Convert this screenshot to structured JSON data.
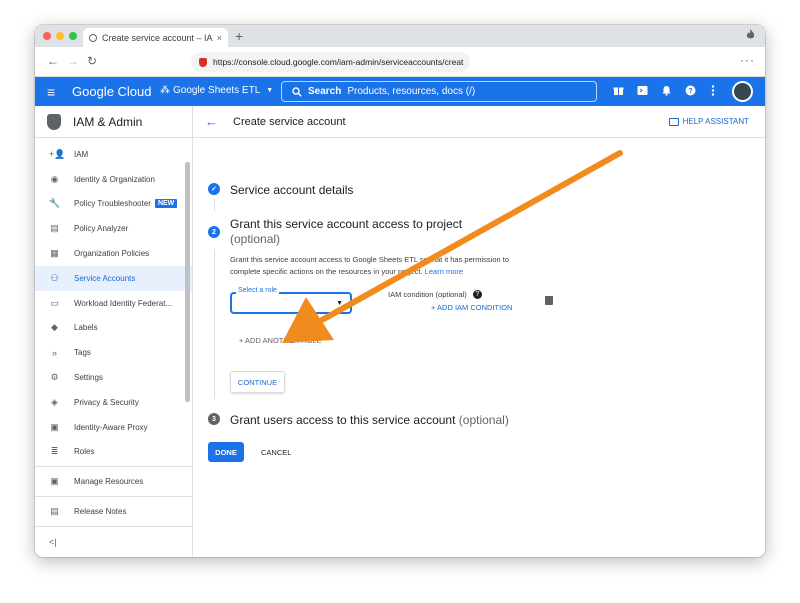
{
  "browser": {
    "tab_title": "Create service account – IAM",
    "tab_close": "×",
    "new_tab": "+",
    "url": "https://console.cloud.google.com/iam-admin/serviceaccounts/creat",
    "back": "←",
    "forward": "→",
    "reload": "↻",
    "more": "···"
  },
  "header": {
    "menu": "≡",
    "brand": "Google Cloud",
    "project": "Google Sheets ETL",
    "project_caret": "▼",
    "search_label": "Search",
    "search_placeholder": "Products, resources, docs (/)"
  },
  "sidebar": {
    "title": "IAM & Admin",
    "items": [
      {
        "label": "IAM",
        "icon": "+👤"
      },
      {
        "label": "Identity & Organization",
        "icon": "◉"
      },
      {
        "label": "Policy Troubleshooter",
        "icon": "🔧",
        "badge": "NEW"
      },
      {
        "label": "Policy Analyzer",
        "icon": "▤"
      },
      {
        "label": "Organization Policies",
        "icon": "▦"
      },
      {
        "label": "Service Accounts",
        "icon": "⚇"
      },
      {
        "label": "Workload Identity Federat...",
        "icon": "▭"
      },
      {
        "label": "Labels",
        "icon": "◆"
      },
      {
        "label": "Tags",
        "icon": "»"
      },
      {
        "label": "Settings",
        "icon": "⚙"
      },
      {
        "label": "Privacy & Security",
        "icon": "◈"
      },
      {
        "label": "Identity-Aware Proxy",
        "icon": "▣"
      },
      {
        "label": "Roles",
        "icon": "≣"
      }
    ],
    "footer_items": [
      {
        "label": "Manage Resources",
        "icon": "▣"
      },
      {
        "label": "Release Notes",
        "icon": "▤"
      }
    ],
    "collapse": "<|"
  },
  "main": {
    "back": "←",
    "title": "Create service account",
    "help": "HELP ASSISTANT",
    "step1": {
      "mark": "✓",
      "title": "Service account details"
    },
    "step2": {
      "num": "2",
      "title": "Grant this service account access to project",
      "optional": "(optional)",
      "desc": "Grant this service account access to Google Sheets ETL so that it has permission to complete specific actions on the resources in your project.",
      "learn_more": "Learn more",
      "select_label": "Select a role",
      "caret": "▼",
      "iam_condition": "IAM condition (optional)",
      "help_mark": "?",
      "add_condition": "+  ADD IAM CONDITION",
      "add_role": "+  ADD ANOTHER ROLE",
      "continue": "CONTINUE"
    },
    "step3": {
      "num": "3",
      "title": "Grant users access to this service account",
      "optional": "(optional)"
    },
    "done": "DONE",
    "cancel": "CANCEL"
  },
  "colors": {
    "primary": "#1a73e8",
    "arrow": "#f28b1e"
  }
}
